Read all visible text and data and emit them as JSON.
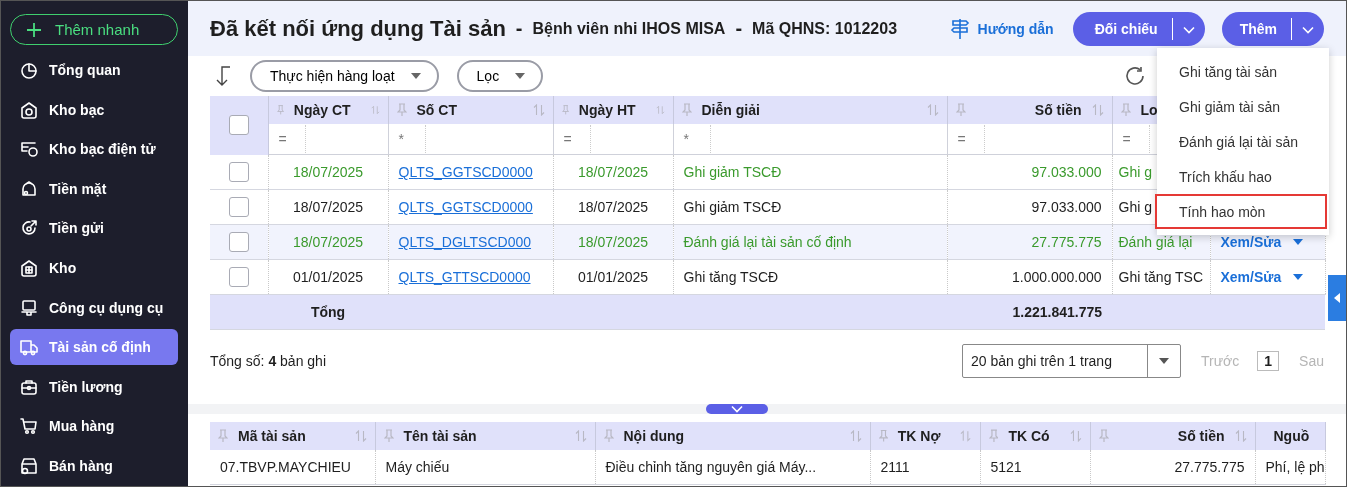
{
  "sidebar": {
    "quick_add": "Thêm nhanh",
    "items": [
      {
        "label": "Tổng quan",
        "selected": false
      },
      {
        "label": "Kho bạc",
        "selected": false
      },
      {
        "label": "Kho bạc điện tử",
        "selected": false
      },
      {
        "label": "Tiền mặt",
        "selected": false
      },
      {
        "label": "Tiền gửi",
        "selected": false
      },
      {
        "label": "Kho",
        "selected": false
      },
      {
        "label": "Công cụ dụng cụ",
        "selected": false
      },
      {
        "label": "Tài sản cố định",
        "selected": true
      },
      {
        "label": "Tiền lương",
        "selected": false
      },
      {
        "label": "Mua hàng",
        "selected": false
      },
      {
        "label": "Bán hàng",
        "selected": false
      }
    ]
  },
  "header": {
    "title": "Đã kết nối ứng dụng Tài sản",
    "separators": [
      "-",
      "-"
    ],
    "unit": "Bệnh viên nhi IHOS MISA",
    "code": "Mã QHNS: 1012203",
    "guide": "Hướng dẫn",
    "buttons": [
      "Đối chiếu",
      "Thêm"
    ]
  },
  "menu": {
    "items": [
      {
        "label": "Ghi tăng tài sản",
        "highlighted": false
      },
      {
        "label": "Ghi giảm tài sản",
        "highlighted": false
      },
      {
        "label": "Đánh giá lại tài sản",
        "highlighted": false
      },
      {
        "label": "Trích khấu hao",
        "highlighted": false
      },
      {
        "label": "Tính hao mòn",
        "highlighted": true
      }
    ]
  },
  "toolbar": {
    "bulk_action": "Thực hiện hàng loạt",
    "filter": "Lọc"
  },
  "table": {
    "all_checked": false,
    "columns": [
      {
        "label": "Ngày CT",
        "filter": "=",
        "kind": "date",
        "sortable": true
      },
      {
        "label": "Số CT",
        "filter": "*",
        "kind": "link",
        "sortable": true
      },
      {
        "label": "Ngày HT",
        "filter": "=",
        "kind": "date",
        "sortable": true
      },
      {
        "label": "Diễn giải",
        "filter": "*",
        "kind": "text",
        "sortable": true
      },
      {
        "label": "Số tiền",
        "filter": "=",
        "kind": "number",
        "sortable": true
      },
      {
        "label": "Lo",
        "filter": "=",
        "kind": "text",
        "sortable": false
      }
    ],
    "rows": [
      {
        "checked": false,
        "hovered": false,
        "color": "#3a9a2c",
        "cells": [
          "18/07/2025",
          "QLTS_GGTSCD0000",
          "18/07/2025",
          "Ghi giảm TSCĐ",
          "97.033.000",
          "Ghi g"
        ]
      },
      {
        "checked": false,
        "hovered": false,
        "color": "#1f1f1f",
        "cells": [
          "18/07/2025",
          "QLTS_GGTSCD0000",
          "18/07/2025",
          "Ghi giảm TSCĐ",
          "97.033.000",
          "Ghi g"
        ]
      },
      {
        "checked": false,
        "hovered": true,
        "color": "#3a9a2c",
        "cells": [
          "18/07/2025",
          "QLTS_DGLTSCD000",
          "18/07/2025",
          "Đánh giá lại tài sản cố định",
          "27.775.775",
          "Đánh giá lại"
        ],
        "action": "Xem/Sửa"
      },
      {
        "checked": false,
        "hovered": false,
        "color": "#1f1f1f",
        "cells": [
          "01/01/2025",
          "QLTS_GTTSCD0000",
          "01/01/2025",
          "Ghi tăng TSCĐ",
          "1.000.000.000",
          "Ghi tăng TSC"
        ],
        "action": "Xem/Sửa"
      }
    ],
    "total": {
      "label": "Tổng",
      "amount": "1.221.841.775"
    }
  },
  "footer": {
    "count": "Tổng số: **4** bản ghi",
    "page_size": "20 bản ghi trên 1 trang",
    "prev": {
      "label": "Trước",
      "disabled": true
    },
    "page": "1",
    "next": {
      "label": "Sau",
      "disabled": true
    }
  },
  "detail_table": {
    "columns": [
      {
        "label": "Mã tài sản",
        "kind": "text",
        "sortable": true
      },
      {
        "label": "Tên tài sản",
        "kind": "text",
        "sortable": true
      },
      {
        "label": "Nội dung",
        "kind": "text",
        "sortable": true
      },
      {
        "label": "TK Nợ",
        "kind": "text",
        "sortable": true
      },
      {
        "label": "TK Có",
        "kind": "text",
        "sortable": true
      },
      {
        "label": "Số tiền",
        "kind": "number",
        "sortable": true
      },
      {
        "label": "Nguồ",
        "kind": "text",
        "sortable": false
      }
    ],
    "rows": [
      [
        "07.TBVP.MAYCHIEU",
        "Máy chiếu",
        "Điều chỉnh tăng nguyên giá Máy...",
        "2111",
        "5121",
        "27.775.775",
        "Phí, lệ ph"
      ]
    ]
  }
}
